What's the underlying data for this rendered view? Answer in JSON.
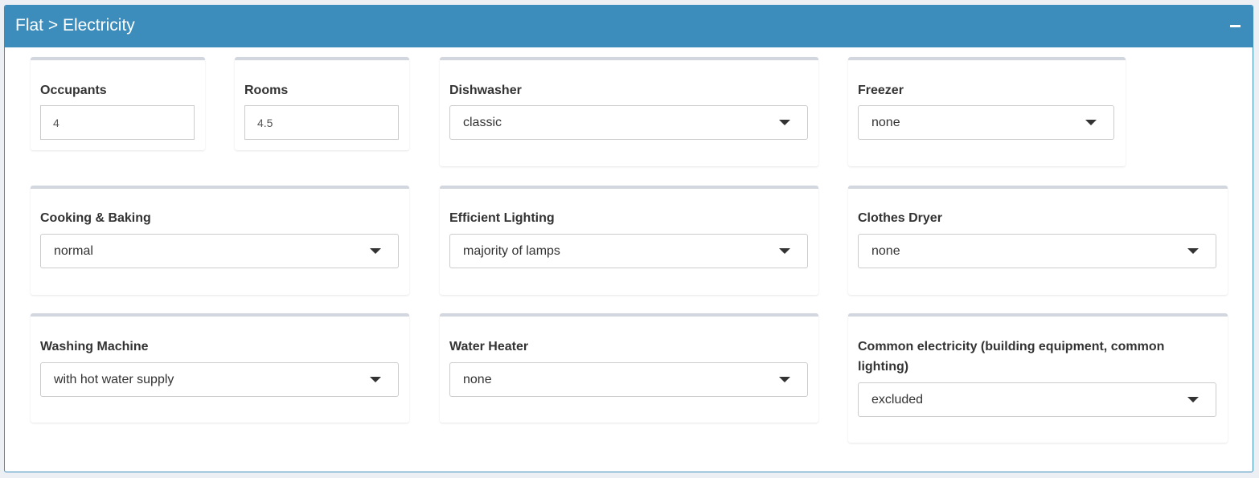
{
  "panel": {
    "title": "Flat > Electricity",
    "header_color": "#3c8dbc"
  },
  "fields": {
    "occupants": {
      "label": "Occupants",
      "value": "4"
    },
    "rooms": {
      "label": "Rooms",
      "value": "4.5"
    },
    "dishwasher": {
      "label": "Dishwasher",
      "value": "classic"
    },
    "freezer": {
      "label": "Freezer",
      "value": "none"
    },
    "cooking": {
      "label": "Cooking & Baking",
      "value": "normal"
    },
    "lighting": {
      "label": "Efficient Lighting",
      "value": "majority of lamps"
    },
    "dryer": {
      "label": "Clothes Dryer",
      "value": "none"
    },
    "washing": {
      "label": "Washing Machine",
      "value": "with hot water supply"
    },
    "water_heater": {
      "label": "Water Heater",
      "value": "none"
    },
    "common": {
      "label_line1": "Common electricity (building equipment, common",
      "label_line2": "lighting)",
      "value": "excluded"
    }
  },
  "icons": {
    "collapse": "minus-icon",
    "dropdown": "caret-down-icon"
  }
}
